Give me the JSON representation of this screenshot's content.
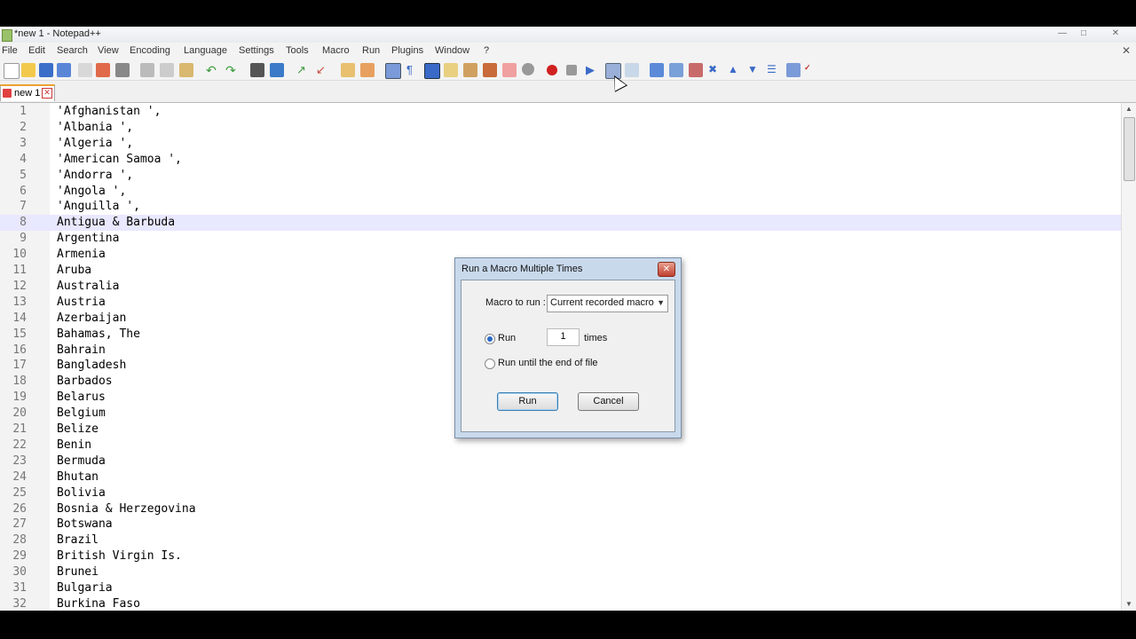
{
  "window": {
    "title": "*new 1 - Notepad++"
  },
  "menu": {
    "items": [
      "File",
      "Edit",
      "Search",
      "View",
      "Encoding",
      "Language",
      "Settings",
      "Tools",
      "Macro",
      "Run",
      "Plugins",
      "Window",
      "?"
    ]
  },
  "tab": {
    "label": "new 1"
  },
  "editor": {
    "lines": [
      "'Afghanistan ',",
      "'Albania ',",
      "'Algeria ',",
      "'American Samoa ',",
      "'Andorra ',",
      "'Angola ',",
      "'Anguilla ',",
      "Antigua & Barbuda",
      "Argentina",
      "Armenia",
      "Aruba",
      "Australia",
      "Austria",
      "Azerbaijan",
      "Bahamas, The",
      "Bahrain",
      "Bangladesh",
      "Barbados",
      "Belarus",
      "Belgium",
      "Belize",
      "Benin",
      "Bermuda",
      "Bhutan",
      "Bolivia",
      "Bosnia & Herzegovina",
      "Botswana",
      "Brazil",
      "British Virgin Is.",
      "Brunei",
      "Bulgaria",
      "Burkina Faso"
    ],
    "current_line": 8
  },
  "dialog": {
    "title": "Run a Macro Multiple Times",
    "macro_label": "Macro to run :",
    "macro_value": "Current recorded macro",
    "run_label": "Run",
    "times_value": "1",
    "times_label": "times",
    "until_end_label": "Run until the end of file",
    "run_button": "Run",
    "cancel_button": "Cancel"
  }
}
